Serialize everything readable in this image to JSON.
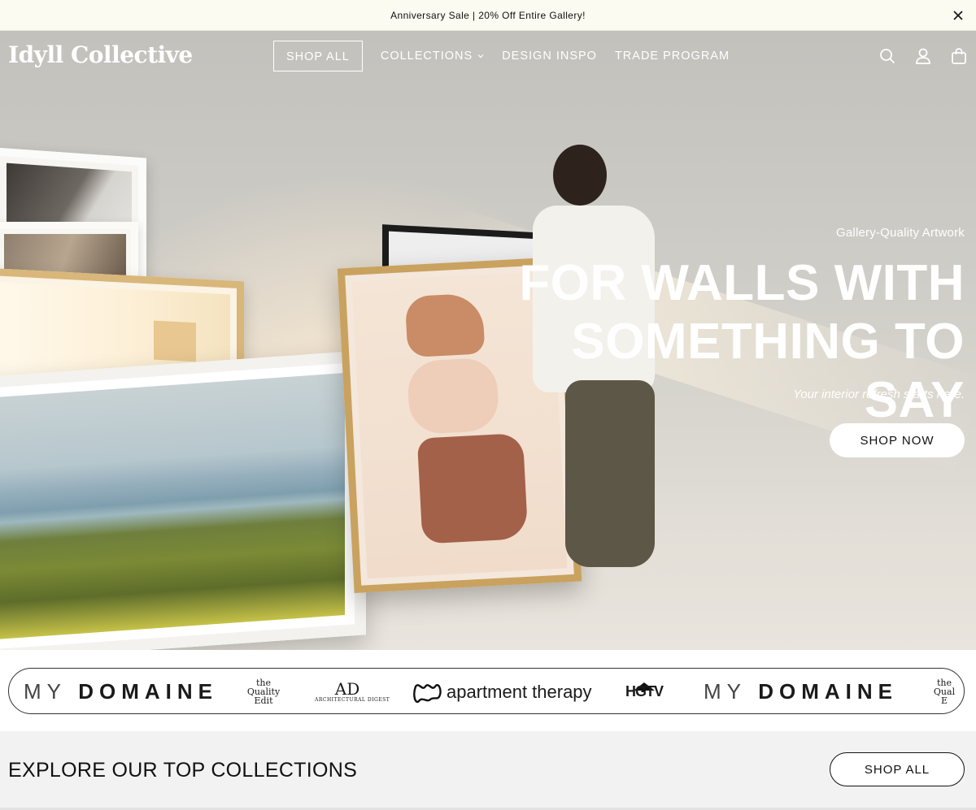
{
  "announcement": {
    "text": "Anniversary Sale | 20% Off Entire Gallery!",
    "close_icon": "close-icon"
  },
  "header": {
    "logo": "Idyll Collective",
    "nav": [
      {
        "label": "SHOP ALL"
      },
      {
        "label": "COLLECTIONS"
      },
      {
        "label": "DESIGN INSPO"
      },
      {
        "label": "TRADE PROGRAM"
      }
    ],
    "icons": [
      "search-icon",
      "account-icon",
      "cart-icon"
    ]
  },
  "hero": {
    "eyebrow": "Gallery-Quality Artwork",
    "headline_line1": "FOR WALLS WITH",
    "headline_line2": "SOMETHING TO SAY",
    "subline": "Your interior refresh starts here.",
    "cta": "SHOP NOW"
  },
  "press": {
    "logos": [
      {
        "name": "mydomaine-logo",
        "text_my": "MY",
        "text_domaine": "DOMAINE"
      },
      {
        "name": "quality-edit-logo",
        "line1": "the",
        "line2": "Quality",
        "line3": "Edit"
      },
      {
        "name": "architectural-digest-logo",
        "mark": "AD",
        "text": "ARCHITECTURAL DIGEST"
      },
      {
        "name": "apartment-therapy-logo",
        "text": "apartment therapy"
      },
      {
        "name": "hgtv-logo",
        "text": "HGTV"
      },
      {
        "name": "mydomaine-logo-2",
        "text_my": "MY",
        "text_domaine": "DOMAINE"
      },
      {
        "name": "quality-edit-logo-2",
        "line1": "the",
        "line2": "Qual",
        "line3": "E"
      }
    ]
  },
  "explore": {
    "title": "EXPLORE OUR TOP COLLECTIONS",
    "cta": "SHOP ALL"
  }
}
